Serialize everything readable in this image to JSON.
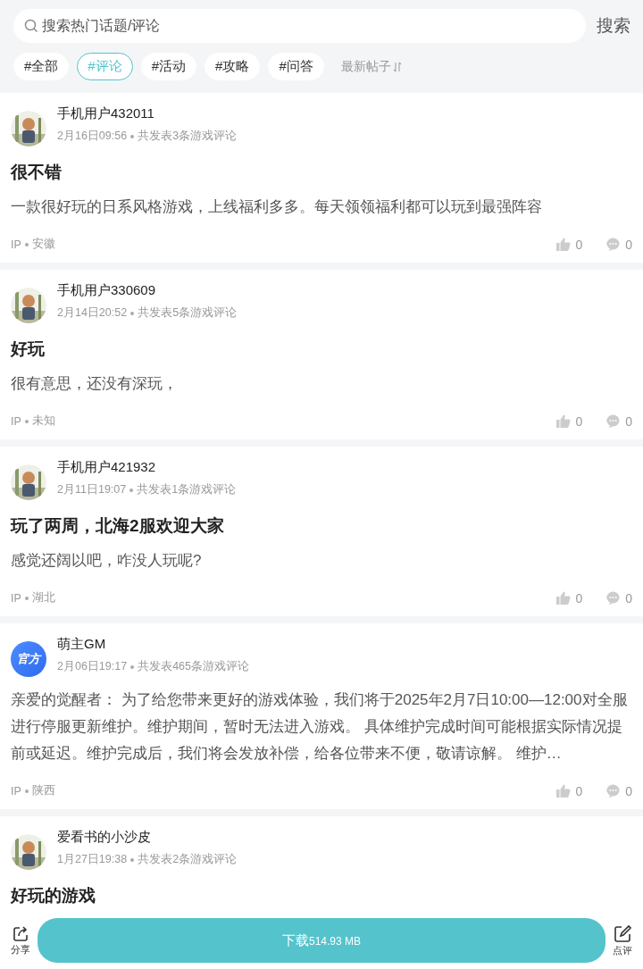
{
  "search": {
    "placeholder": "搜索热门话题/评论",
    "button": "搜索"
  },
  "tags": [
    {
      "label": "#全部",
      "selected": false
    },
    {
      "label": "#评论",
      "selected": true
    },
    {
      "label": "#活动",
      "selected": false
    },
    {
      "label": "#攻略",
      "selected": false
    },
    {
      "label": "#问答",
      "selected": false
    }
  ],
  "sort": {
    "label": "最新帖子"
  },
  "posts": [
    {
      "user": "手机用户432011",
      "date": "2月16日09:56",
      "summary": "共发表3条游戏评论",
      "title": "很不错",
      "body": "一款很好玩的日系风格游戏，上线福利多多。每天领领福利都可以玩到最强阵容",
      "ip_label": "IP",
      "region": "安徽",
      "likes": "0",
      "comments": "0"
    },
    {
      "user": "手机用户330609",
      "date": "2月14日20:52",
      "summary": "共发表5条游戏评论",
      "title": "好玩",
      "body": "很有意思，还没有深玩，",
      "ip_label": "IP",
      "region": "未知",
      "likes": "0",
      "comments": "0"
    },
    {
      "user": "手机用户421932",
      "date": "2月11日19:07",
      "summary": "共发表1条游戏评论",
      "title": "玩了两周，北海2服欢迎大家",
      "body": "感觉还阔以吧，咋没人玩呢?",
      "ip_label": "IP",
      "region": "湖北",
      "likes": "0",
      "comments": "0"
    },
    {
      "user": "萌主GM",
      "avatar": {
        "kind": "official",
        "text": "官方"
      },
      "date": "2月06日19:17",
      "summary": "共发表465条游戏评论",
      "body": "亲爱的觉醒者： 为了给您带来更好的游戏体验，我们将于2025年2月7日10:00—12:00对全服进行停服更新维护。维护期间，暂时无法进入游戏。 具体维护完成时间可能根据实际情况提前或延迟。维护完成后，我们将会发放补偿，给各位带来不便，敬请谅解。 维护…",
      "ip_label": "IP",
      "region": "陕西",
      "likes": "0",
      "comments": "0"
    },
    {
      "user": "爱看书的小沙皮",
      "date": "1月27日19:38",
      "summary": "共发表2条游戏评论",
      "title": "好玩的游戏"
    }
  ],
  "bottom_bar": {
    "share": "分享",
    "download": "下载",
    "size": "514.93 MB",
    "review": "点评"
  }
}
